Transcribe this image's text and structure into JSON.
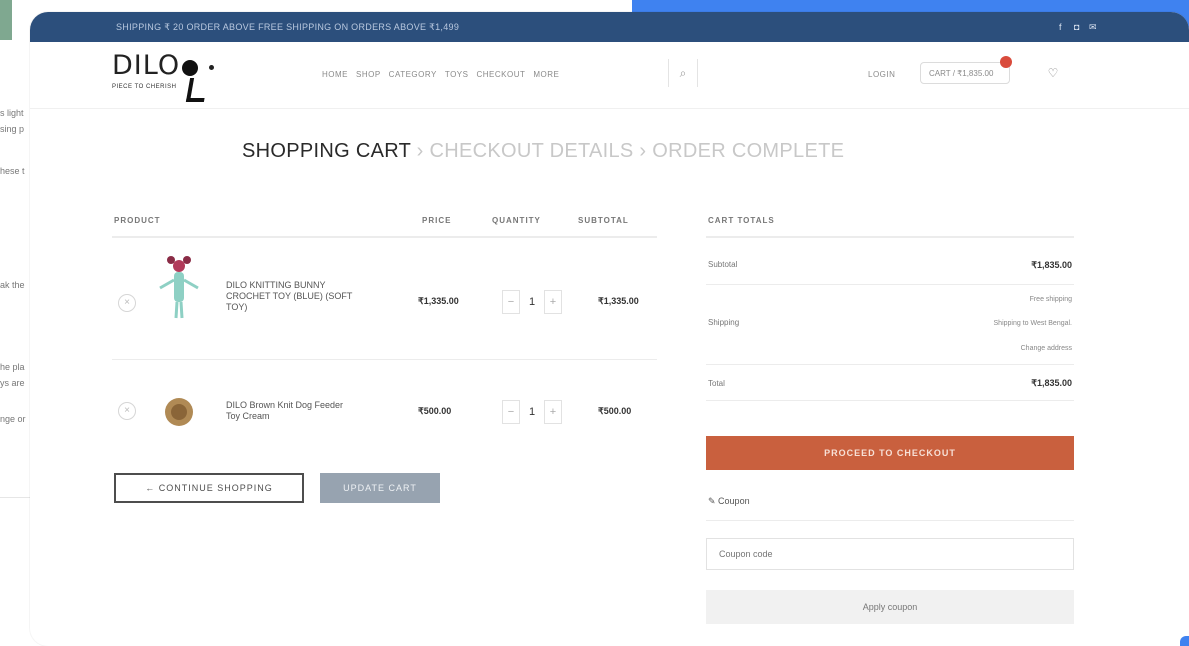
{
  "colors": {
    "accent_blue": "#3f82f0",
    "topbar": "#2c4f7c",
    "checkout_button": "#c9603e",
    "update_button": "#97a3b0"
  },
  "background_page": {
    "snippets": [
      "s light",
      "sing p",
      "hese t",
      "ak the",
      "he pla",
      "ys are",
      "nge or"
    ]
  },
  "topbar": {
    "promo": "SHIPPING ₹ 20 ORDER ABOVE FREE SHIPPING ON ORDERS ABOVE ₹1,499",
    "social_icons": [
      "facebook-icon",
      "instagram-icon",
      "mail-icon"
    ]
  },
  "header": {
    "logo_text": "DILO",
    "logo_subtitle": "PIECE TO CHERISH",
    "nav": [
      "HOME",
      "SHOP",
      "CATEGORY",
      "TOYS",
      "CHECKOUT",
      "MORE"
    ],
    "search_icon": "search-icon",
    "login": "LOGIN",
    "cart_label": "CART / ₹1,835.00",
    "wishlist_icon": "heart-icon"
  },
  "steps": {
    "step1": "SHOPPING CART",
    "step2": "CHECKOUT DETAILS",
    "step3": "ORDER COMPLETE",
    "separator": "›"
  },
  "cart": {
    "headers": {
      "product": "PRODUCT",
      "price": "PRICE",
      "quantity": "QUANTITY",
      "subtotal": "SUBTOTAL"
    },
    "items": [
      {
        "name": "DILO KNITTING BUNNY CROCHET TOY (BLUE) (SOFT TOY)",
        "price": "₹1,335.00",
        "quantity": "1",
        "subtotal": "₹1,335.00"
      },
      {
        "name": "DILO Brown Knit Dog Feeder Toy Cream",
        "price": "₹500.00",
        "quantity": "1",
        "subtotal": "₹500.00"
      }
    ],
    "continue_label": "← CONTINUE SHOPPING",
    "update_label": "UPDATE CART"
  },
  "totals": {
    "heading": "CART TOTALS",
    "subtotal_label": "Subtotal",
    "subtotal_value": "₹1,835.00",
    "shipping_label": "Shipping",
    "shipping_method": "Free shipping",
    "shipping_to": "Shipping to West Bengal.",
    "change_address": "Change address",
    "total_label": "Total",
    "total_value": "₹1,835.00",
    "checkout_label": "PROCEED TO CHECKOUT",
    "coupon_heading": "Coupon",
    "coupon_placeholder": "Coupon code",
    "apply_label": "Apply coupon"
  }
}
